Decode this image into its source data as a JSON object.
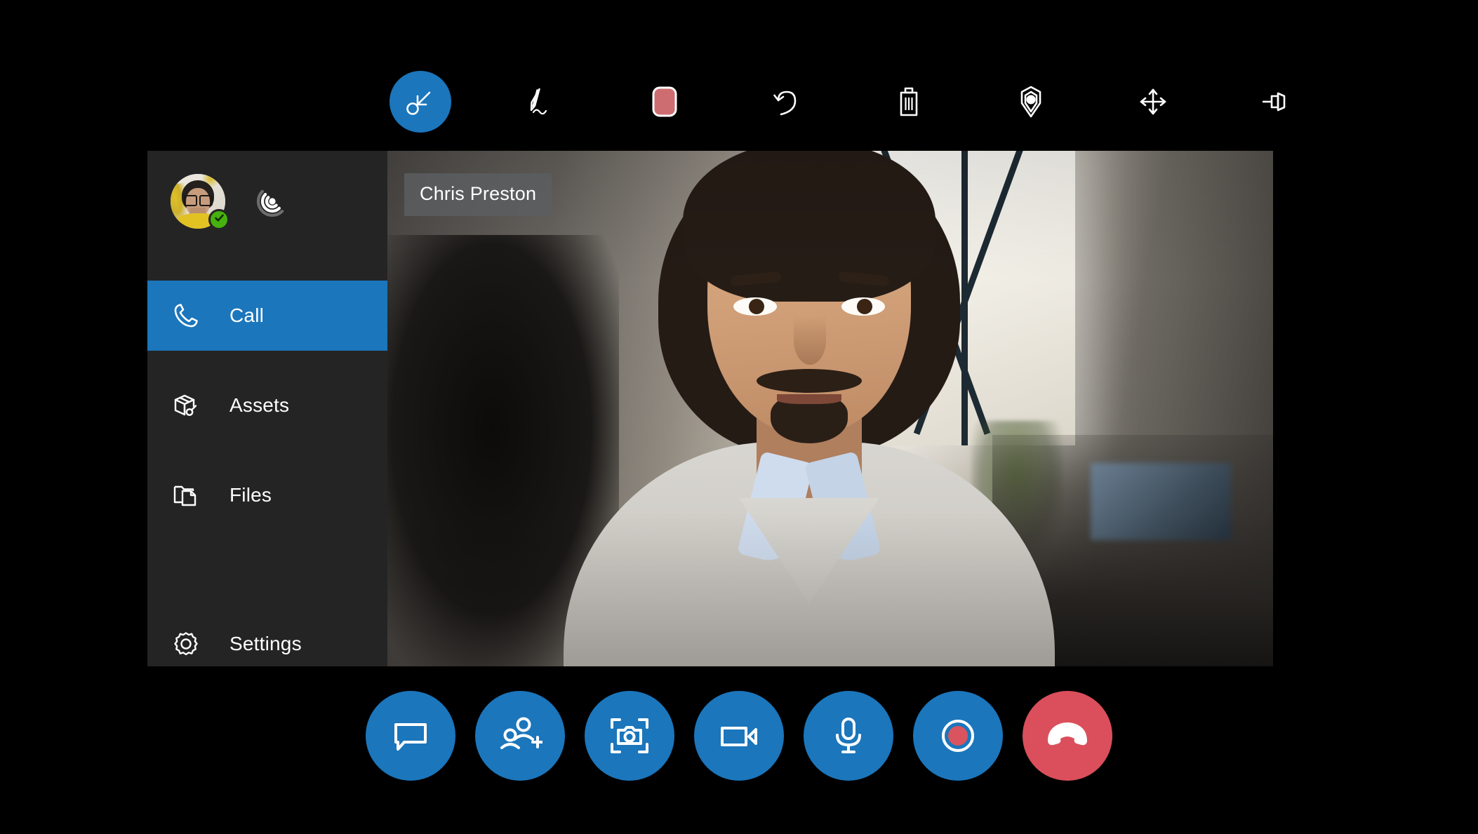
{
  "app": {
    "background_color": "#000000",
    "accent_color": "#1b76bc",
    "danger_color": "#da4f5b",
    "panel_color": "#242424",
    "record_color": "#d9545f"
  },
  "toolbar": {
    "items": [
      {
        "id": "select-point",
        "icon": "point-arrow-icon",
        "label": "Point",
        "active": true
      },
      {
        "id": "draw",
        "icon": "pen-icon",
        "label": "Draw",
        "active": false
      },
      {
        "id": "color",
        "icon": "color-swatch-icon",
        "label": "Color",
        "active": false,
        "swatch_color": "#cd6d72"
      },
      {
        "id": "undo",
        "icon": "undo-icon",
        "label": "Undo",
        "active": false
      },
      {
        "id": "delete",
        "icon": "trash-icon",
        "label": "Delete",
        "active": false
      },
      {
        "id": "marker",
        "icon": "location-marker-icon",
        "label": "Marker",
        "active": false
      },
      {
        "id": "move",
        "icon": "move-arrows-icon",
        "label": "Move",
        "active": false
      },
      {
        "id": "pin",
        "icon": "pushpin-icon",
        "label": "Pin",
        "active": false
      }
    ]
  },
  "sidebar": {
    "profile": {
      "avatar_alt": "User avatar",
      "status": "available",
      "status_icon": "check-icon",
      "status_color": "#46b10e",
      "connection_icon": "signal-strength-icon",
      "connection_bars": 3,
      "connection_active_bars": 2
    },
    "items": [
      {
        "id": "call",
        "label": "Call",
        "icon": "phone-icon",
        "selected": true
      },
      {
        "id": "assets",
        "label": "Assets",
        "icon": "box-wrench-icon",
        "selected": false
      },
      {
        "id": "files",
        "label": "Files",
        "icon": "folder-document-icon",
        "selected": false
      },
      {
        "id": "settings",
        "label": "Settings",
        "icon": "gear-icon",
        "selected": false
      }
    ]
  },
  "video": {
    "participant_name": "Chris Preston",
    "name_tag_background": "rgba(92,94,96,.82)"
  },
  "controls": {
    "buttons": [
      {
        "id": "chat",
        "icon": "chat-bubble-icon",
        "label": "Chat",
        "style": "primary"
      },
      {
        "id": "add-participant",
        "icon": "add-person-icon",
        "label": "Add participant",
        "style": "primary"
      },
      {
        "id": "snapshot",
        "icon": "camera-capture-icon",
        "label": "Snapshot",
        "style": "primary"
      },
      {
        "id": "video-toggle",
        "icon": "video-camera-icon",
        "label": "Camera",
        "style": "primary"
      },
      {
        "id": "mic-toggle",
        "icon": "microphone-icon",
        "label": "Microphone",
        "style": "primary"
      },
      {
        "id": "record",
        "icon": "record-icon",
        "label": "Record",
        "style": "primary"
      },
      {
        "id": "hang-up",
        "icon": "hang-up-phone-icon",
        "label": "End call",
        "style": "danger"
      }
    ]
  }
}
